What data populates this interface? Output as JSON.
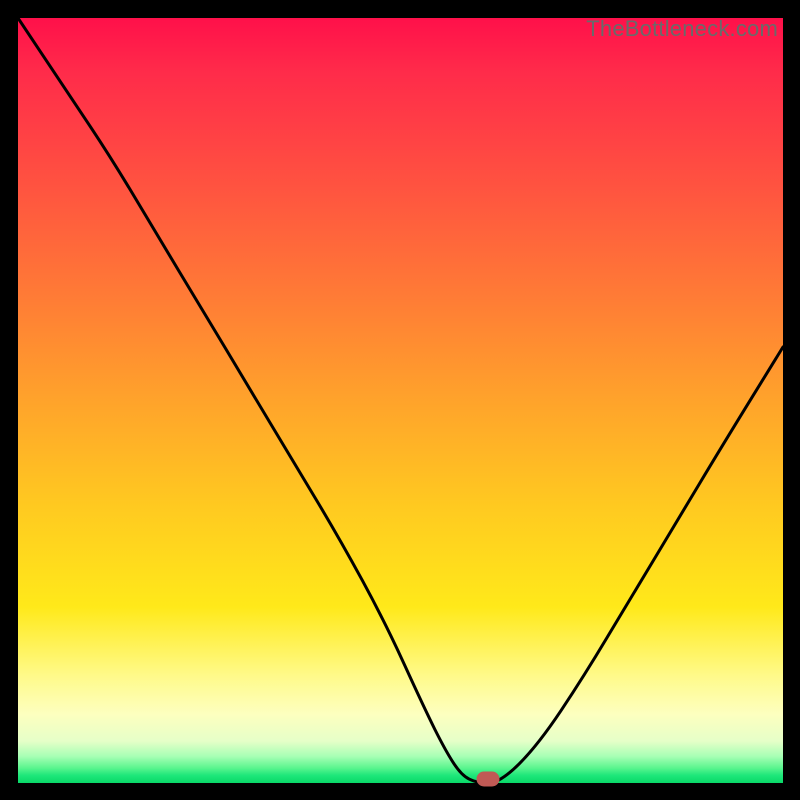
{
  "watermark": "TheBottleneck.com",
  "chart_data": {
    "type": "line",
    "title": "",
    "xlabel": "",
    "ylabel": "",
    "xlim": [
      0,
      100
    ],
    "ylim": [
      0,
      100
    ],
    "grid": false,
    "legend": false,
    "series": [
      {
        "name": "bottleneck-curve",
        "x": [
          0,
          6,
          12,
          18,
          24,
          30,
          36,
          42,
          48,
          53,
          56,
          58,
          60,
          63,
          68,
          74,
          80,
          86,
          92,
          100
        ],
        "y": [
          100,
          91,
          82,
          72,
          62,
          52,
          42,
          32,
          21,
          10,
          4,
          1,
          0,
          0,
          5,
          14,
          24,
          34,
          44,
          57
        ]
      }
    ],
    "marker": {
      "x": 61.5,
      "y": 0.5
    },
    "gradient_stops": [
      {
        "pos": 0,
        "color": "#ff104a"
      },
      {
        "pos": 7,
        "color": "#ff2b4a"
      },
      {
        "pos": 22,
        "color": "#ff5340"
      },
      {
        "pos": 36,
        "color": "#ff7a36"
      },
      {
        "pos": 50,
        "color": "#ffa32b"
      },
      {
        "pos": 64,
        "color": "#ffca20"
      },
      {
        "pos": 77,
        "color": "#ffe91a"
      },
      {
        "pos": 86,
        "color": "#fffa8a"
      },
      {
        "pos": 91,
        "color": "#fdffbf"
      },
      {
        "pos": 94.5,
        "color": "#e6ffc8"
      },
      {
        "pos": 96.5,
        "color": "#a8ffb5"
      },
      {
        "pos": 98,
        "color": "#5cf58f"
      },
      {
        "pos": 99,
        "color": "#1ee77a"
      },
      {
        "pos": 100,
        "color": "#09d968"
      }
    ]
  }
}
